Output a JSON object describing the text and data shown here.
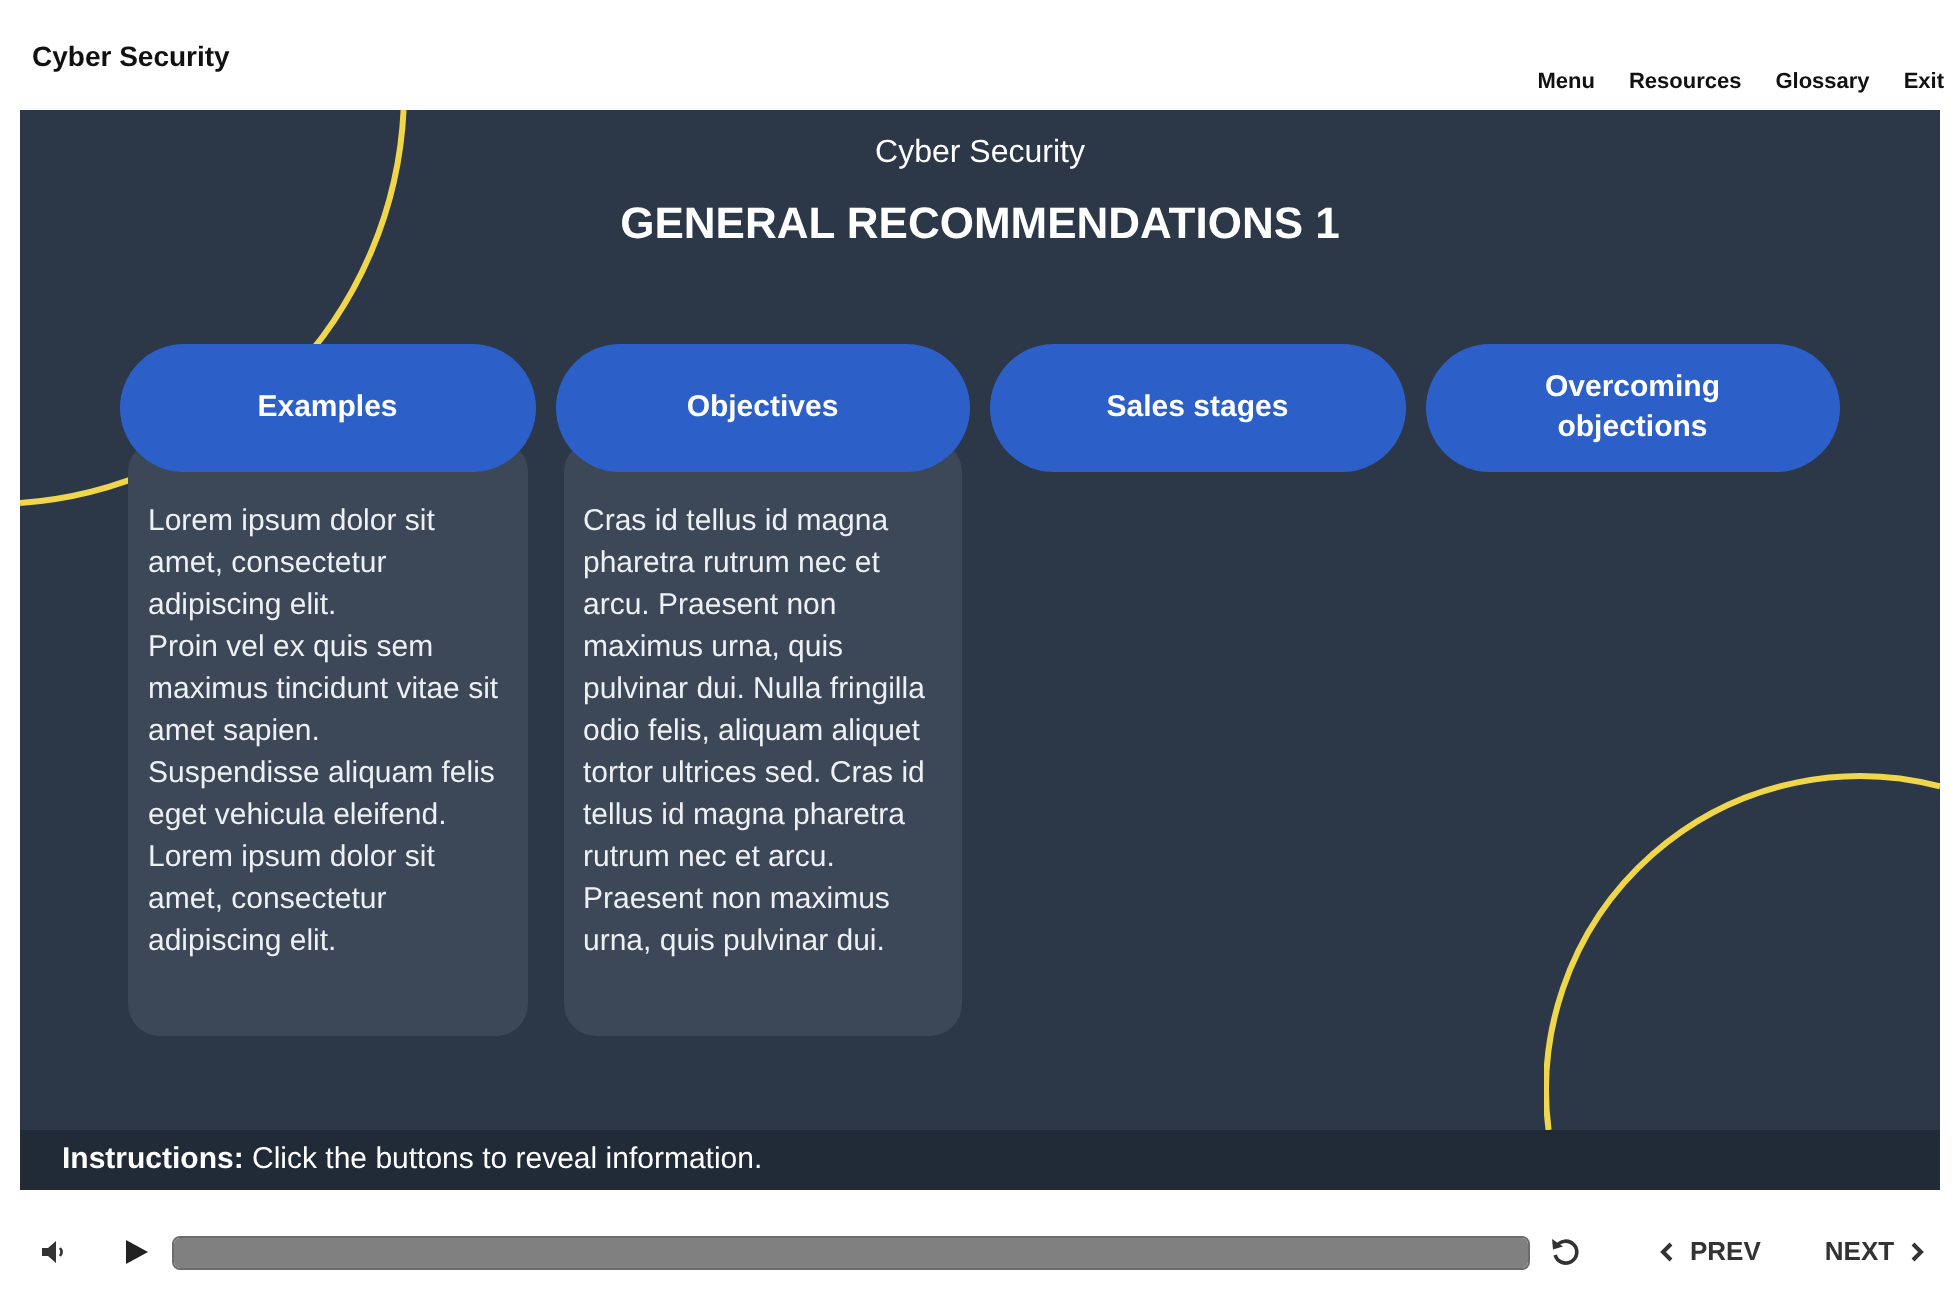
{
  "header": {
    "title": "Cyber Security",
    "nav": [
      "Menu",
      "Resources",
      "Glossary",
      "Exit"
    ]
  },
  "slide": {
    "subtitle": "Cyber Security",
    "title": "GENERAL RECOMMENDATIONS 1",
    "tabs": [
      {
        "label": "Examples",
        "expanded": true,
        "paragraphs": [
          "Lorem ipsum dolor sit amet, consectetur adipiscing elit.",
          "Proin vel ex quis sem maximus tincidunt vitae sit amet sapien.",
          "Suspendisse aliquam felis eget vehicula eleifend.",
          "Lorem ipsum dolor sit amet, consectetur adipiscing elit."
        ]
      },
      {
        "label": "Objectives",
        "expanded": true,
        "paragraphs": [
          "Cras id tellus id magna pharetra rutrum nec et arcu. Praesent non maximus urna, quis pulvinar dui. Nulla fringilla odio felis, aliquam aliquet tortor ultrices sed. Cras id tellus id magna pharetra rutrum nec et arcu. Praesent non maximus urna, quis pulvinar dui."
        ]
      },
      {
        "label": "Sales stages",
        "expanded": false
      },
      {
        "label": "Overcoming objections",
        "expanded": false
      }
    ]
  },
  "instructions": "**Instructions:** Click the buttons to reveal information.",
  "player": {
    "progress": {
      "level": 1
    },
    "prev": "PREV",
    "next": "NEXT"
  }
}
